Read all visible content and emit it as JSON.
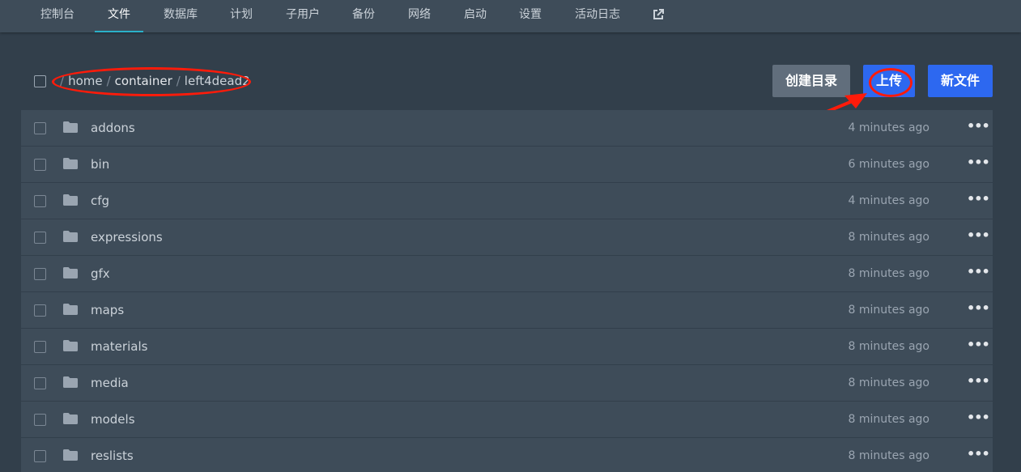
{
  "nav": {
    "items": [
      {
        "label": "控制台"
      },
      {
        "label": "文件",
        "active": true
      },
      {
        "label": "数据库"
      },
      {
        "label": "计划"
      },
      {
        "label": "子用户"
      },
      {
        "label": "备份"
      },
      {
        "label": "网络"
      },
      {
        "label": "启动"
      },
      {
        "label": "设置"
      },
      {
        "label": "活动日志"
      }
    ],
    "external_icon": "external-link-icon"
  },
  "breadcrumb": {
    "root": "/",
    "segments": [
      "home",
      "container",
      "left4dead2"
    ],
    "separator": "/"
  },
  "actions": {
    "mkdir_label": "创建目录",
    "upload_label": "上传",
    "newfile_label": "新文件"
  },
  "files": [
    {
      "name": "addons",
      "modified": "4 minutes ago"
    },
    {
      "name": "bin",
      "modified": "6 minutes ago"
    },
    {
      "name": "cfg",
      "modified": "4 minutes ago"
    },
    {
      "name": "expressions",
      "modified": "8 minutes ago"
    },
    {
      "name": "gfx",
      "modified": "8 minutes ago"
    },
    {
      "name": "maps",
      "modified": "8 minutes ago"
    },
    {
      "name": "materials",
      "modified": "8 minutes ago"
    },
    {
      "name": "media",
      "modified": "8 minutes ago"
    },
    {
      "name": "models",
      "modified": "8 minutes ago"
    },
    {
      "name": "reslists",
      "modified": "8 minutes ago"
    }
  ],
  "row_menu_glyph": "•••",
  "colors": {
    "background": "#323f4b",
    "nav": "#3e4c59",
    "accent": "#2bb0c9",
    "primary_button": "#2d68f0",
    "secondary_button": "#616e7c",
    "annotation": "#ff1b0a"
  }
}
